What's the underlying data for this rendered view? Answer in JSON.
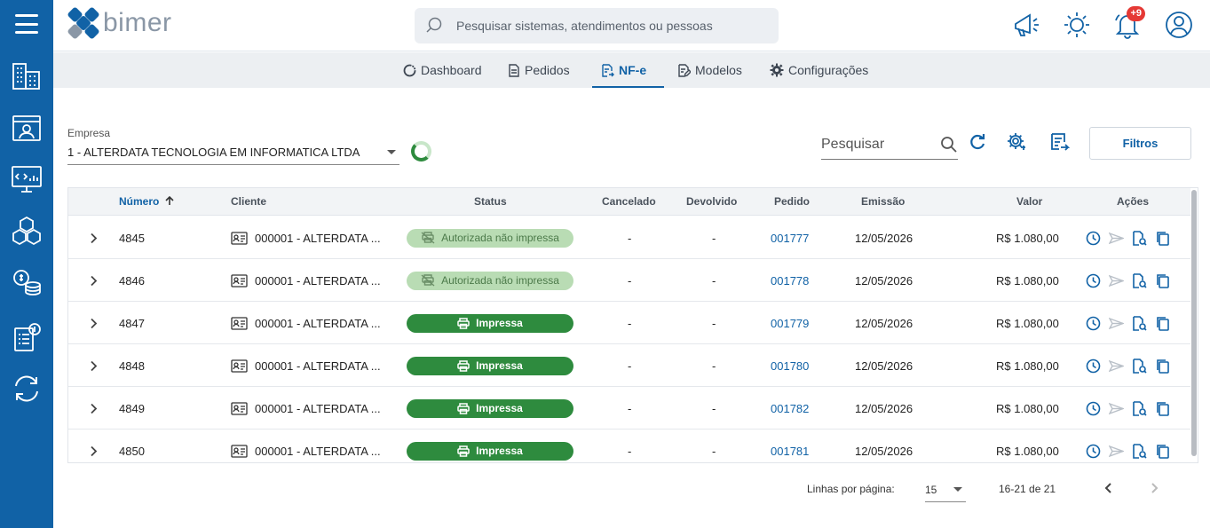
{
  "app": {
    "logo_text": "bimer"
  },
  "search": {
    "placeholder": "Pesquisar sistemas, atendimentos ou pessoas"
  },
  "notifications": {
    "badge": "+9"
  },
  "tabs": [
    {
      "label": "Dashboard",
      "icon": "dashboard-icon"
    },
    {
      "label": "Pedidos",
      "icon": "document-icon"
    },
    {
      "label": "NF-e",
      "icon": "invoice-icon",
      "active": true
    },
    {
      "label": "Modelos",
      "icon": "template-icon"
    },
    {
      "label": "Configurações",
      "icon": "gear-icon"
    }
  ],
  "filters": {
    "empresa_label": "Empresa",
    "empresa_value": "1 - ALTERDATA TECNOLOGIA EM INFORMATICA LTDA",
    "search_label": "Pesquisar",
    "filtros_button": "Filtros"
  },
  "table": {
    "headers": {
      "numero": "Número",
      "cliente": "Cliente",
      "status": "Status",
      "cancelado": "Cancelado",
      "devolvido": "Devolvido",
      "pedido": "Pedido",
      "emissao": "Emissão",
      "valor": "Valor",
      "acoes": "Ações"
    },
    "rows": [
      {
        "numero": "4845",
        "cliente": "000001 - ALTERDATA ...",
        "status": "Autorizada não impressa",
        "status_type": "auth",
        "cancelado": "-",
        "devolvido": "-",
        "pedido": "001777",
        "emissao": "12/05/2026",
        "valor": "R$ 1.080,00"
      },
      {
        "numero": "4846",
        "cliente": "000001 - ALTERDATA ...",
        "status": "Autorizada não impressa",
        "status_type": "auth",
        "cancelado": "-",
        "devolvido": "-",
        "pedido": "001778",
        "emissao": "12/05/2026",
        "valor": "R$ 1.080,00"
      },
      {
        "numero": "4847",
        "cliente": "000001 - ALTERDATA ...",
        "status": "Impressa",
        "status_type": "imp",
        "cancelado": "-",
        "devolvido": "-",
        "pedido": "001779",
        "emissao": "12/05/2026",
        "valor": "R$ 1.080,00"
      },
      {
        "numero": "4848",
        "cliente": "000001 - ALTERDATA ...",
        "status": "Impressa",
        "status_type": "imp",
        "cancelado": "-",
        "devolvido": "-",
        "pedido": "001780",
        "emissao": "12/05/2026",
        "valor": "R$ 1.080,00"
      },
      {
        "numero": "4849",
        "cliente": "000001 - ALTERDATA ...",
        "status": "Impressa",
        "status_type": "imp",
        "cancelado": "-",
        "devolvido": "-",
        "pedido": "001782",
        "emissao": "12/05/2026",
        "valor": "R$ 1.080,00"
      },
      {
        "numero": "4850",
        "cliente": "000001 - ALTERDATA ...",
        "status": "Impressa",
        "status_type": "imp",
        "cancelado": "-",
        "devolvido": "-",
        "pedido": "001781",
        "emissao": "12/05/2026",
        "valor": "R$ 1.080,00"
      }
    ]
  },
  "pagination": {
    "rows_label": "Linhas por página:",
    "rows_value": "15",
    "range": "16-21 de 21"
  },
  "colors": {
    "primary": "#1162a6",
    "success": "#2e8b3e",
    "success_light": "#b9dcb4",
    "badge": "#e53935"
  }
}
